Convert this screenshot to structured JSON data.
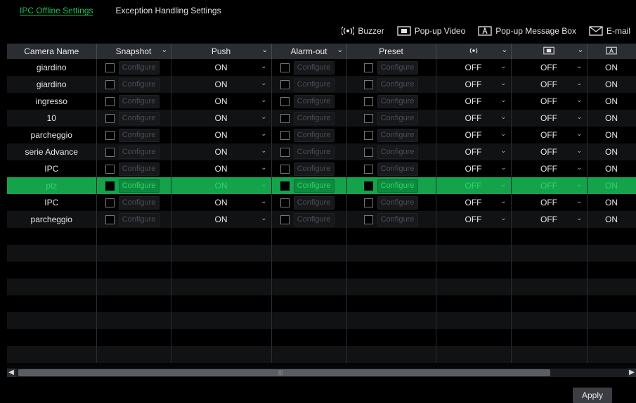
{
  "tabs": [
    "IPC Offline Settings",
    "Exception Handling Settings"
  ],
  "legend": [
    {
      "icon": "buzzer-icon",
      "label": "Buzzer"
    },
    {
      "icon": "popup-video-icon",
      "label": "Pop-up Video"
    },
    {
      "icon": "popup-message-icon",
      "label": "Pop-up Message Box"
    },
    {
      "icon": "email-icon",
      "label": "E-mail"
    }
  ],
  "table": {
    "headers": {
      "camera": "Camera Name",
      "snapshot": "Snapshot",
      "push": "Push",
      "alarm_out": "Alarm-out",
      "preset": "Preset"
    },
    "configure_label": "Configure",
    "rows": [
      {
        "name": "giardino",
        "push": "ON",
        "buzzer": "OFF",
        "popup_video": "OFF",
        "popup_msg": "ON",
        "selected": false
      },
      {
        "name": "giardino",
        "push": "ON",
        "buzzer": "OFF",
        "popup_video": "OFF",
        "popup_msg": "ON",
        "selected": false
      },
      {
        "name": "ingresso",
        "push": "ON",
        "buzzer": "OFF",
        "popup_video": "OFF",
        "popup_msg": "ON",
        "selected": false
      },
      {
        "name": "10",
        "push": "ON",
        "buzzer": "OFF",
        "popup_video": "OFF",
        "popup_msg": "ON",
        "selected": false
      },
      {
        "name": "parcheggio",
        "push": "ON",
        "buzzer": "OFF",
        "popup_video": "OFF",
        "popup_msg": "ON",
        "selected": false
      },
      {
        "name": "serie Advance",
        "push": "ON",
        "buzzer": "OFF",
        "popup_video": "OFF",
        "popup_msg": "ON",
        "selected": false
      },
      {
        "name": "IPC",
        "push": "ON",
        "buzzer": "OFF",
        "popup_video": "OFF",
        "popup_msg": "ON",
        "selected": false
      },
      {
        "name": "ptz",
        "push": "ON",
        "buzzer": "OFF",
        "popup_video": "OFF",
        "popup_msg": "ON",
        "selected": true
      },
      {
        "name": "IPC",
        "push": "ON",
        "buzzer": "OFF",
        "popup_video": "OFF",
        "popup_msg": "ON",
        "selected": false
      },
      {
        "name": "parcheggio",
        "push": "ON",
        "buzzer": "OFF",
        "popup_video": "OFF",
        "popup_msg": "ON",
        "selected": false
      }
    ]
  },
  "apply_label": "Apply",
  "colors": {
    "accent": "#20c05c",
    "selected_row": "#14a34b",
    "header_bg": "#2a2e33"
  }
}
